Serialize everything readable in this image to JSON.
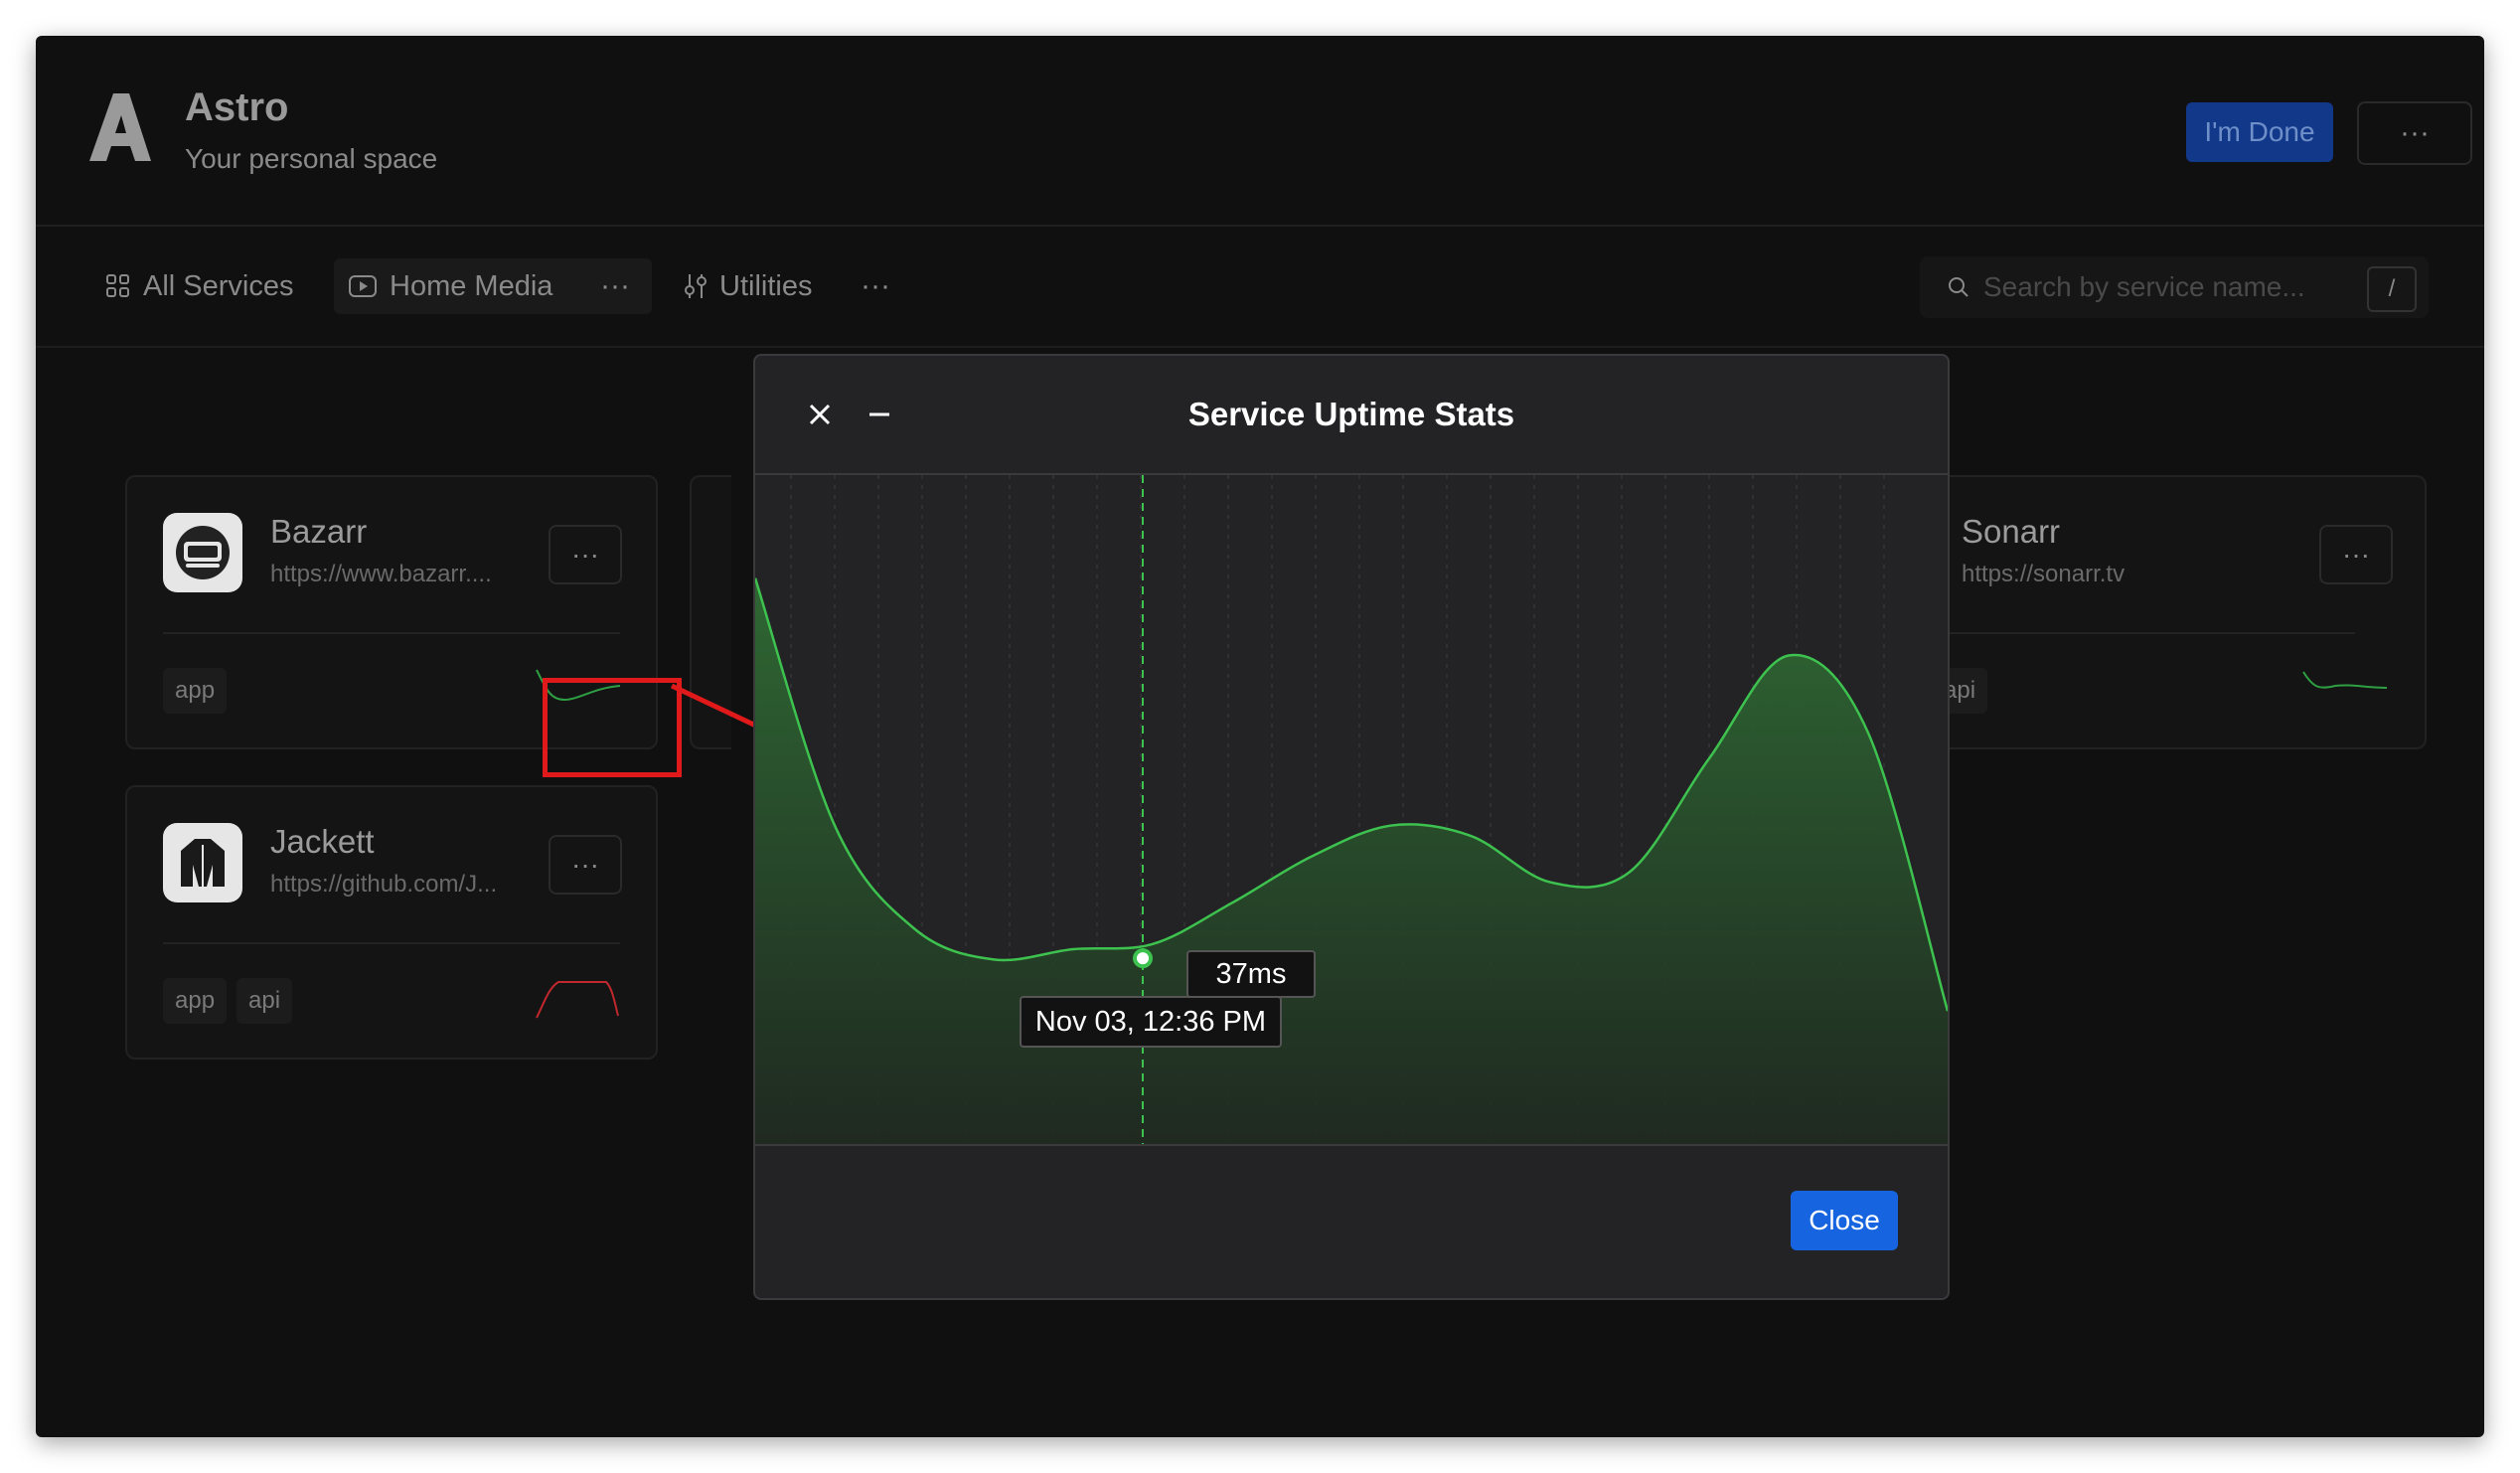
{
  "app": {
    "title": "Astro",
    "subtitle": "Your personal space",
    "done_label": "I'm Done",
    "more_label": "···"
  },
  "tabs": [
    {
      "label": "All Services",
      "icon": "grid-icon"
    },
    {
      "label": "Home Media",
      "icon": "play-icon",
      "active": true
    },
    {
      "label": "Utilities",
      "icon": "sliders-icon"
    }
  ],
  "search": {
    "placeholder": "Search by service name...",
    "shortcut": "/"
  },
  "services": [
    {
      "name": "Bazarr",
      "url": "https://www.bazarr....",
      "tags": [
        "app"
      ],
      "spark_color": "#2ea043"
    },
    {
      "name": "Jackett",
      "url": "https://github.com/J...",
      "tags": [
        "app",
        "api"
      ],
      "spark_color": "#c0282d"
    },
    {
      "name": "Sonarr",
      "url": "https://sonarr.tv",
      "tags": [
        "api"
      ],
      "spark_color": "#2ea043"
    }
  ],
  "modal": {
    "title": "Service Uptime Stats",
    "close_label": "Close",
    "tooltip_value": "37ms",
    "tooltip_time": "Nov 03, 12:36 PM"
  },
  "chart_data": {
    "type": "area",
    "series": [
      {
        "values": [
          110,
          62,
          42,
          36,
          38,
          39,
          47,
          56,
          62,
          60,
          51,
          53,
          75,
          95,
          80,
          26
        ]
      }
    ],
    "highlighted_value": 37,
    "highlighted_time": "Nov 03, 12:36 PM",
    "ylim": [
      0,
      130
    ],
    "grid": "vertical dashed",
    "line_color": "#3ec24f"
  },
  "colors": {
    "accent": "#1664e0",
    "done_button": "#12388a",
    "uptime_green": "#3ec24f",
    "annotation_red": "#e01a1a"
  }
}
